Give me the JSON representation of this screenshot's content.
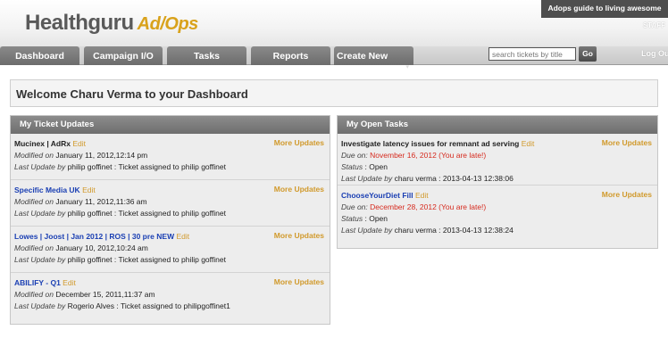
{
  "header": {
    "logo_main": "Healthguru",
    "logo_sub": "Ad/Ops",
    "guide_link": "Adops guide to living awesome",
    "user_role": "STAFF"
  },
  "nav": {
    "tabs": [
      "Dashboard",
      "Campaign I/O",
      "Tasks",
      "Reports",
      "Create New"
    ],
    "search_placeholder": "search tickets by title",
    "go_label": "Go",
    "logout_label": "Log Out"
  },
  "welcome": "Welcome Charu Verma to your Dashboard",
  "ticket_updates": {
    "title": "My Ticket Updates",
    "modified_label": "Modified",
    "on_label": "on",
    "last_update_label": "Last Update",
    "by_label": "by",
    "edit_label": "Edit",
    "more_label": "More Updates",
    "items": [
      {
        "title": "Mucinex | AdRx",
        "modified": "January 11, 2012,12:14 pm",
        "last_update": "philip goffinet : Ticket assigned to philip goffinet"
      },
      {
        "title": "Specific Media UK",
        "modified": "January 11, 2012,11:36 am",
        "last_update": "philip goffinet : Ticket assigned to philip goffinet"
      },
      {
        "title": "Lowes | Joost | Jan 2012 | ROS | 30 pre NEW",
        "modified": "January 10, 2012,10:24 am",
        "last_update": "philip goffinet : Ticket assigned to philip goffinet"
      },
      {
        "title": "ABILIFY - Q1",
        "modified": "December 15, 2011,11:37 am",
        "last_update": "Rogerio Alves : Ticket assigned to philipgoffinet1"
      }
    ]
  },
  "open_tasks": {
    "title": "My Open Tasks",
    "due_label": "Due on:",
    "status_label": "Status",
    "last_update_label": "Last Update",
    "by_label": "by",
    "edit_label": "Edit",
    "more_label": "More Updates",
    "items": [
      {
        "title": "Investigate latency issues for remnant ad serving",
        "due": "November 16, 2012 (You are late!)",
        "status": "Open",
        "last_update": "charu verma : 2013-04-13 12:38:06"
      },
      {
        "title": "ChooseYourDiet Fill",
        "due": "December 28, 2012 (You are late!)",
        "status": "Open",
        "last_update": "charu verma : 2013-04-13 12:38:24"
      }
    ]
  },
  "colors": {
    "accent_orange": "#d19a2c",
    "link_blue": "#1a3fb3",
    "late_red": "#d62b1f",
    "tab_gray": "#7a7a7a"
  }
}
